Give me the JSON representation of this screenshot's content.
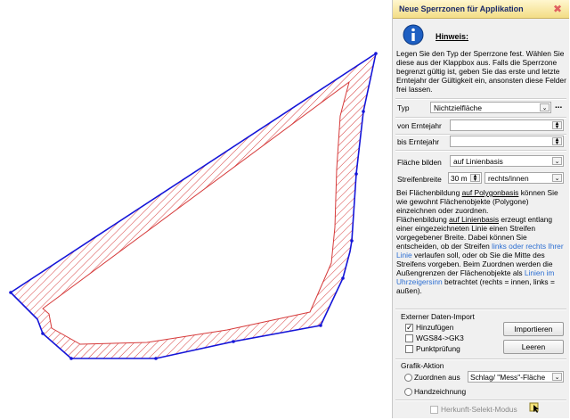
{
  "map": {
    "outline_color": "#1515d8",
    "hatch_color": "#d63b3b"
  },
  "dialog": {
    "title": "Neue Sperrzonen für Applikation",
    "close_glyph": "✖",
    "hint": {
      "icon": "info-icon",
      "title": "Hinweis:",
      "text": "Legen Sie den Typ der Sperrzone fest. Wählen Sie diese aus der Klappbox aus. Falls die Sperrzone begrenzt gültig ist, geben Sie das erste und letzte Erntejahr der Gültigkeit ein, ansonsten diese Felder frei lassen."
    },
    "typ": {
      "label": "Typ",
      "value": "Nichtzielfläche",
      "more": "..."
    },
    "von": {
      "label": "von Erntejahr",
      "value": ""
    },
    "bis": {
      "label": "bis Erntejahr",
      "value": ""
    },
    "flaeche": {
      "label": "Fläche bilden",
      "value": "auf Linienbasis"
    },
    "streifen": {
      "label": "Streifenbreite",
      "value": "30 m",
      "side": "rechts/innen"
    },
    "desc": {
      "p1": "Bei Flächenbildung ",
      "p1u": "auf Polygonbasis",
      "p2": " können Sie wie gewohnt Flächenobjekte (Polygone) einzeichnen oder zuordnen.",
      "p3": "Flächenbildung ",
      "p3u": "auf Linienbasis",
      "p4": " erzeugt entlang einer eingezeichneten Linie einen Streifen vorgegebener Breite. Dabei können Sie entscheiden, ob der Streifen ",
      "p4l": "links oder rechts Ihrer Linie",
      "p5": " verlaufen soll, oder ob Sie die Mitte des Streifens vorgeben. Beim Zuordnen werden die Außengrenzen der Flächenobjekte als ",
      "p5l": "Linien im Uhrzeigersinn",
      "p6": " betrachtet (rechts = innen, links = außen)."
    },
    "import": {
      "title": "Externer Daten-Import",
      "items": [
        {
          "label": "Hinzufügen",
          "checked": true
        },
        {
          "label": "WGS84->GK3",
          "checked": false
        },
        {
          "label": "Punktprüfung",
          "checked": false
        }
      ],
      "import_btn": "Importieren",
      "clear_btn": "Leeren"
    },
    "grafik": {
      "title": "Grafik-Aktion",
      "zuordnen": "Zuordnen aus",
      "zuordnen_value": "Schlag/ \"Mess\"-Fläche",
      "hand": "Handzeichnung"
    },
    "herkunft": "Herkunft-Selekt-Modus"
  }
}
